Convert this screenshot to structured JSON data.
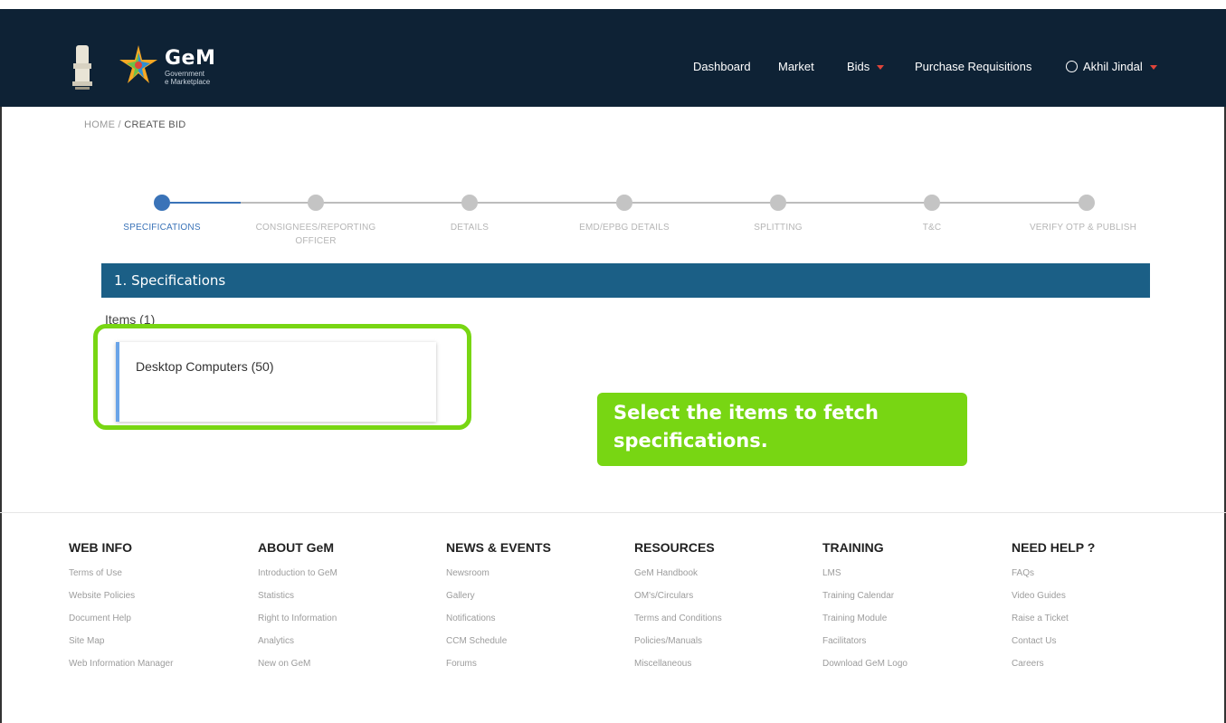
{
  "header": {
    "logo_title": "GeM",
    "logo_sub1": "Government",
    "logo_sub2": "e Marketplace",
    "nav": [
      "Dashboard",
      "Market",
      "Bids",
      "Purchase Requisitions"
    ],
    "user_name": "Akhil Jindal"
  },
  "breadcrumb": {
    "home": "HOME",
    "sep": " / ",
    "current": "CREATE BID"
  },
  "stepper": {
    "active_step": 0,
    "steps": [
      "SPECIFICATIONS",
      "CONSIGNEES/REPORTING OFFICER",
      "DETAILS",
      "EMD/EPBG DETAILS",
      "SPLITTING",
      "T&C",
      "VERIFY OTP & PUBLISH"
    ]
  },
  "section": {
    "title": "1. Specifications",
    "items_title": "Items (1)"
  },
  "items": [
    {
      "label": "Desktop Computers  (50)"
    }
  ],
  "callout": {
    "text": "Select the items to fetch specifications."
  },
  "colors": {
    "header_bg": "#0e2235",
    "section_bar": "#1b5f86",
    "highlight": "#78d613",
    "active_step": "#3a73b8"
  },
  "footer": {
    "columns": [
      {
        "title": "WEB INFO",
        "links": [
          "Terms of Use",
          "Website Policies",
          "Document Help",
          "Site Map",
          "Web Information Manager"
        ]
      },
      {
        "title": "ABOUT GeM",
        "links": [
          "Introduction to GeM",
          "Statistics",
          "Right to Information",
          "Analytics",
          "New on GeM"
        ]
      },
      {
        "title": "NEWS & EVENTS",
        "links": [
          "Newsroom",
          "Gallery",
          "Notifications",
          "CCM Schedule",
          "Forums"
        ]
      },
      {
        "title": "RESOURCES",
        "links": [
          "GeM Handbook",
          "OM's/Circulars",
          "Terms and Conditions",
          "Policies/Manuals",
          "Miscellaneous"
        ]
      },
      {
        "title": "TRAINING",
        "links": [
          "LMS",
          "Training Calendar",
          "Training Module",
          "Facilitators",
          "Download GeM Logo"
        ]
      },
      {
        "title": "NEED HELP ?",
        "links": [
          "FAQs",
          "Video Guides",
          "Raise a Ticket",
          "Contact Us",
          "Careers"
        ]
      }
    ]
  }
}
